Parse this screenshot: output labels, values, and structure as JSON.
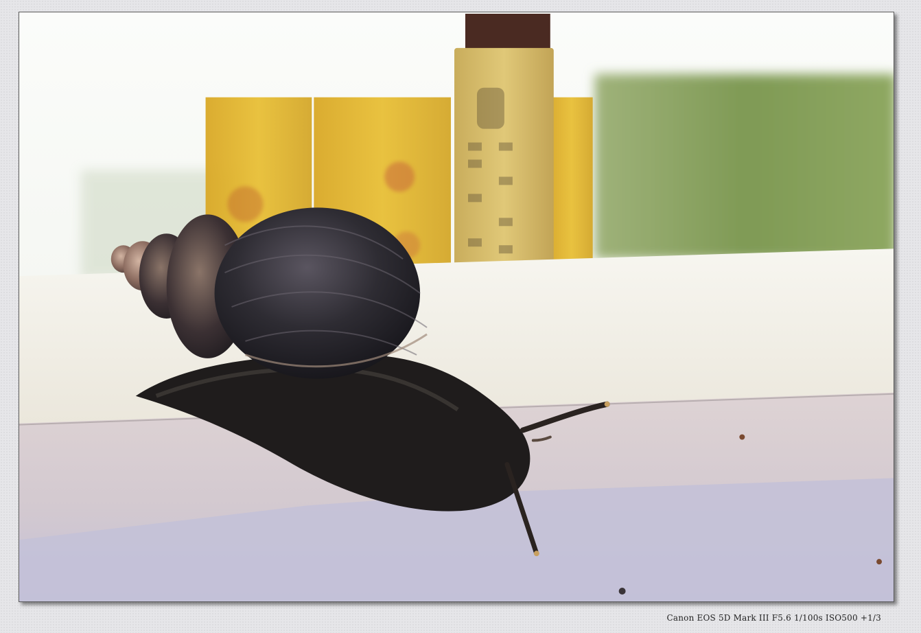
{
  "photo": {
    "subject": "",
    "colors": {
      "sky": "#f4f6f2",
      "foliage": "#7f9a55",
      "ledge_top": "#f0eee6",
      "ledge_front": "#d9cfd3",
      "ledge_shadow": "#c7c3d8",
      "yellow_box": "#e3b830",
      "stamp": "#d8c070",
      "shell_dark": "#2b2a30",
      "snail_body": "#1f1c1c"
    }
  },
  "caption": {
    "exif": "Canon EOS 5D Mark III F5.6 1/100s ISO500 +1/3"
  }
}
